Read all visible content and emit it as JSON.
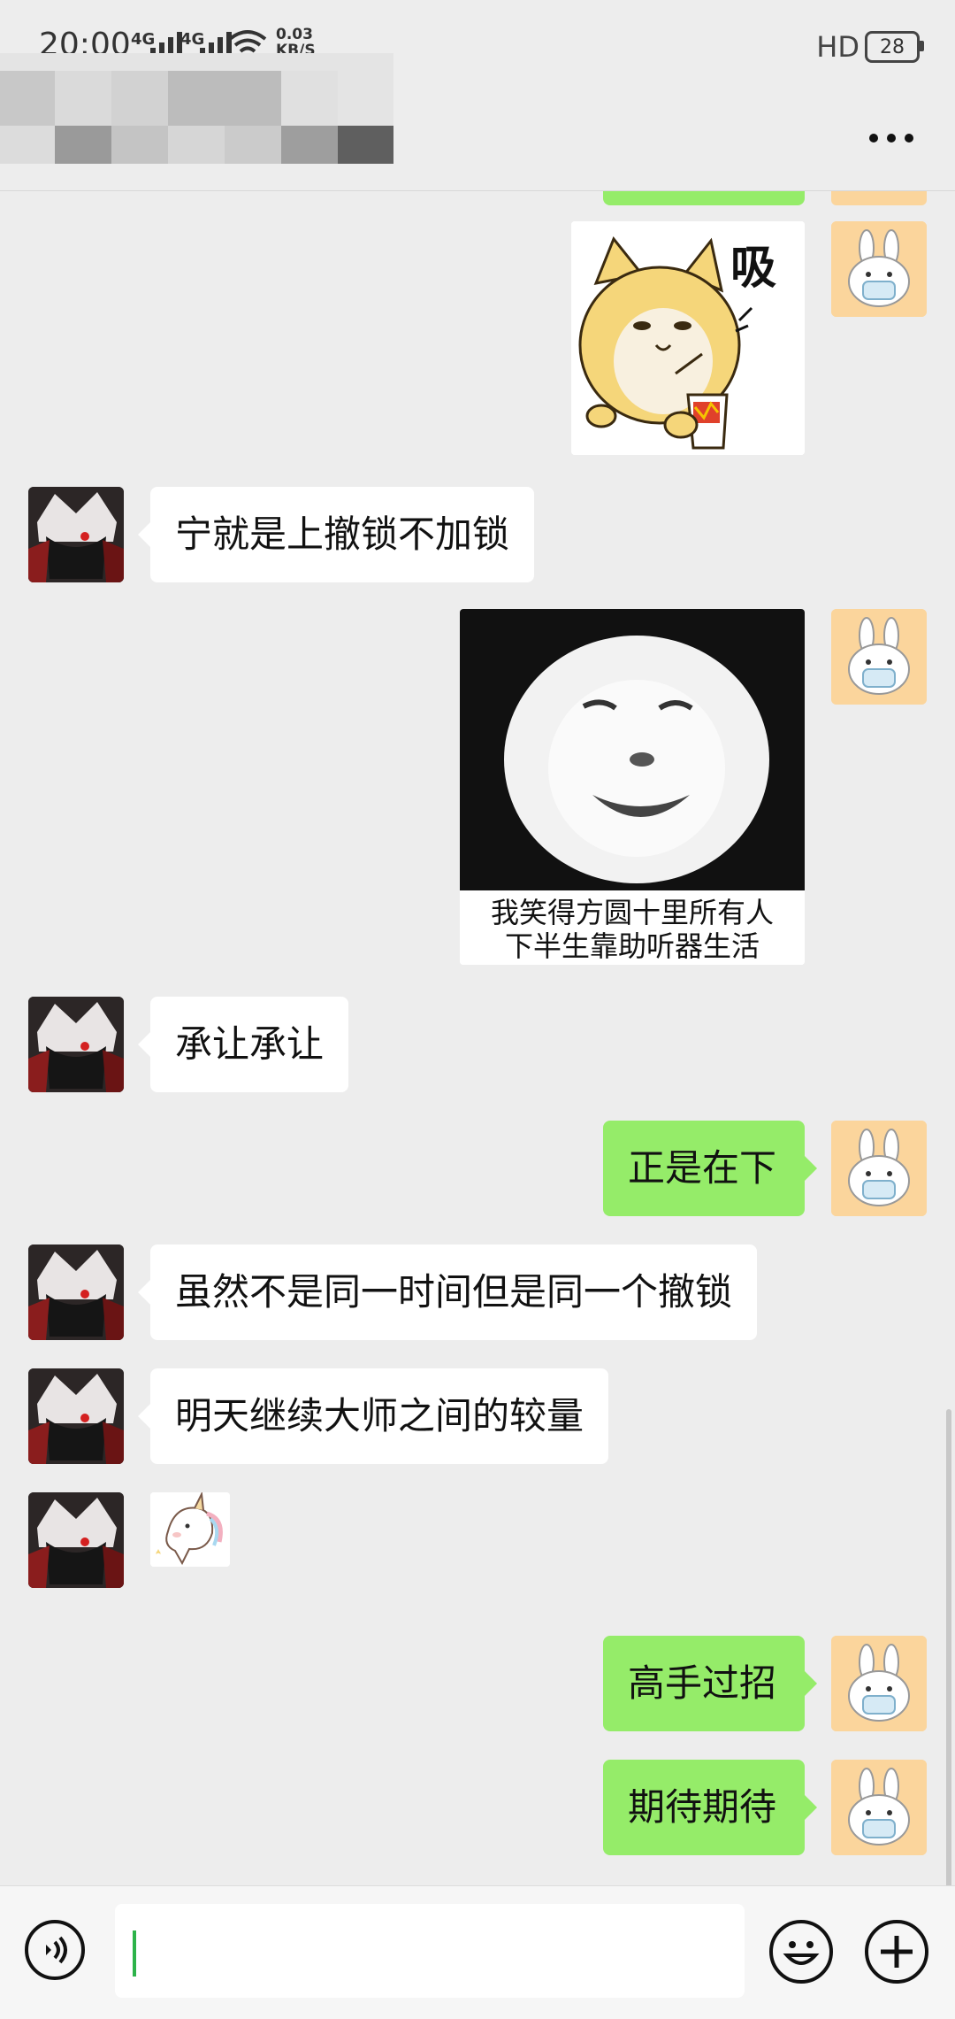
{
  "status_bar": {
    "time": "20:00",
    "network_1": "4G",
    "network_2": "4G",
    "speed_value": "0.03",
    "speed_unit": "KB/S",
    "hd_label": "HD",
    "battery": "28"
  },
  "header": {
    "more_icon": "more-dots-icon"
  },
  "messages": [
    {
      "sender": "me",
      "type": "sticker",
      "sticker": "doge-sipping-drink",
      "text": "吸"
    },
    {
      "sender": "other",
      "type": "text",
      "text": "宁就是上撤锁不加锁"
    },
    {
      "sender": "me",
      "type": "sticker",
      "sticker": "panda-face-laughing",
      "caption_1": "我笑得方圆十里所有人",
      "caption_2": "下半生靠助听器生活"
    },
    {
      "sender": "other",
      "type": "text",
      "text": "承让承让"
    },
    {
      "sender": "me",
      "type": "text",
      "text": "正是在下"
    },
    {
      "sender": "other",
      "type": "text",
      "text": "虽然不是同一时间但是同一个撤锁"
    },
    {
      "sender": "other",
      "type": "text",
      "text": "明天继续大师之间的较量"
    },
    {
      "sender": "other",
      "type": "sticker",
      "sticker": "unicorn-small"
    },
    {
      "sender": "me",
      "type": "text",
      "text": "高手过招"
    },
    {
      "sender": "me",
      "type": "text",
      "text": "期待期待"
    }
  ],
  "input_bar": {
    "voice_icon": "voice-icon",
    "emoji_icon": "emoji-icon",
    "plus_icon": "plus-icon",
    "input_value": ""
  },
  "colors": {
    "background": "#ededed",
    "my_bubble": "#95ec69",
    "other_bubble": "#ffffff",
    "caret": "#2db34a"
  }
}
